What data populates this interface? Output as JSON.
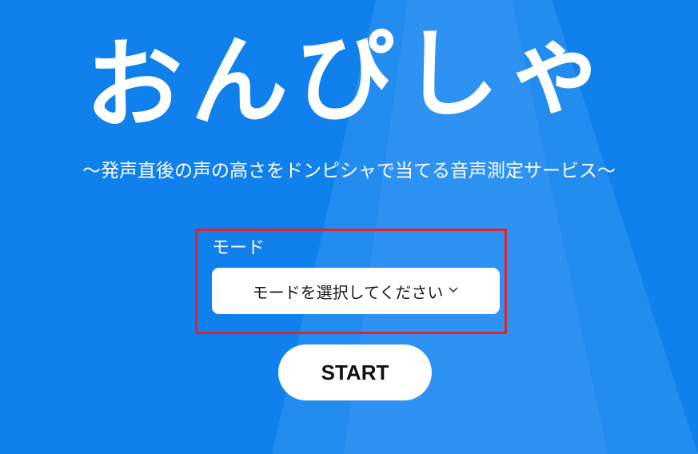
{
  "app": {
    "title": "おんぴしゃ",
    "subtitle": "〜発声直後の声の高さをドンピシャで当てる音声測定サービス〜"
  },
  "mode": {
    "label": "モード",
    "placeholder": "モードを選択してください"
  },
  "actions": {
    "start_label": "START"
  },
  "icons": {
    "dropdown": "chevron-down-icon"
  },
  "colors": {
    "background": "#0f80ec",
    "highlight_border": "#e0232f",
    "text_on_background": "#ffffff"
  }
}
